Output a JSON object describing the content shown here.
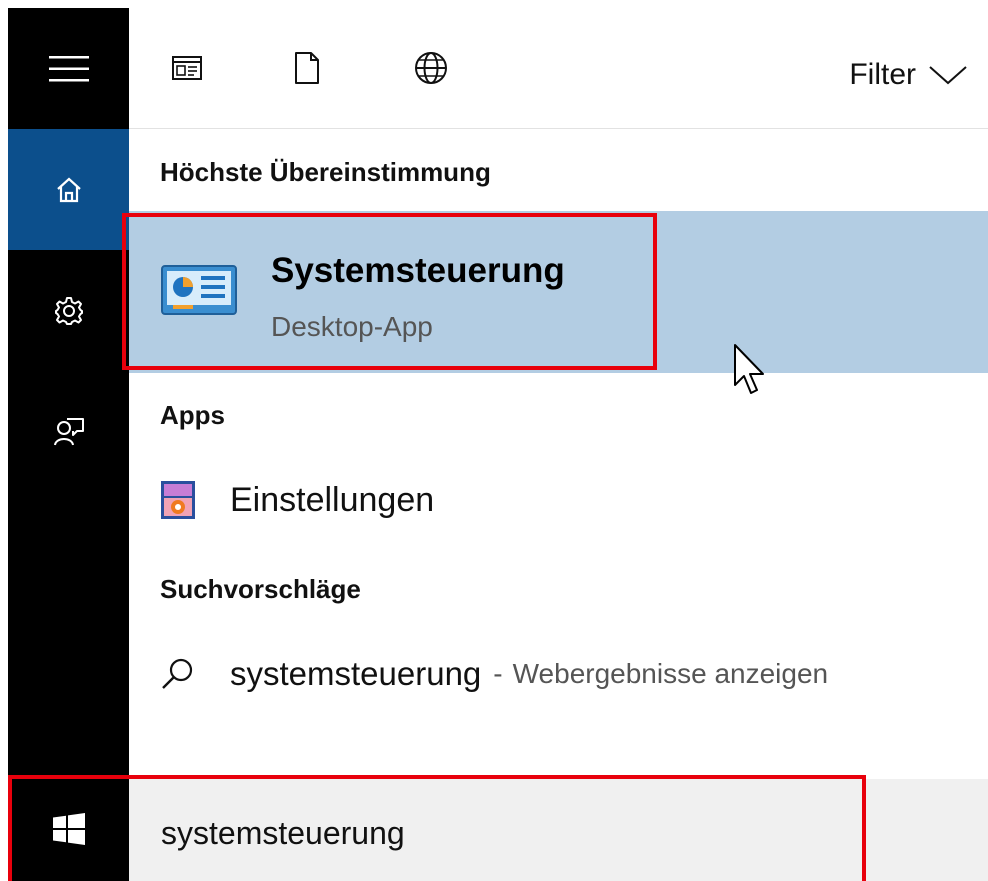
{
  "sidebar": {
    "items": [
      {
        "icon": "hamburger-menu-icon"
      },
      {
        "icon": "home-icon",
        "active": true
      },
      {
        "icon": "gear-icon"
      },
      {
        "icon": "feedback-person-icon"
      }
    ],
    "start_icon": "windows-logo-icon",
    "active_color": "#0c4f8c"
  },
  "toolbar": {
    "icons": [
      "documents-icon",
      "file-icon",
      "globe-icon"
    ],
    "filter_label": "Filter"
  },
  "best_match": {
    "heading": "Höchste Übereinstimmung",
    "title": "Systemsteuerung",
    "subtitle": "Desktop-App",
    "highlight_color": "#b3cde3"
  },
  "apps": {
    "heading": "Apps",
    "items": [
      {
        "label": "Einstellungen"
      }
    ]
  },
  "suggestions": {
    "heading": "Suchvorschläge",
    "items": [
      {
        "query": "systemsteuerung",
        "separator": "-",
        "hint": "Webergebnisse anzeigen"
      }
    ]
  },
  "search": {
    "value": "systemsteuerung"
  },
  "annotation_color": "#e8000c"
}
